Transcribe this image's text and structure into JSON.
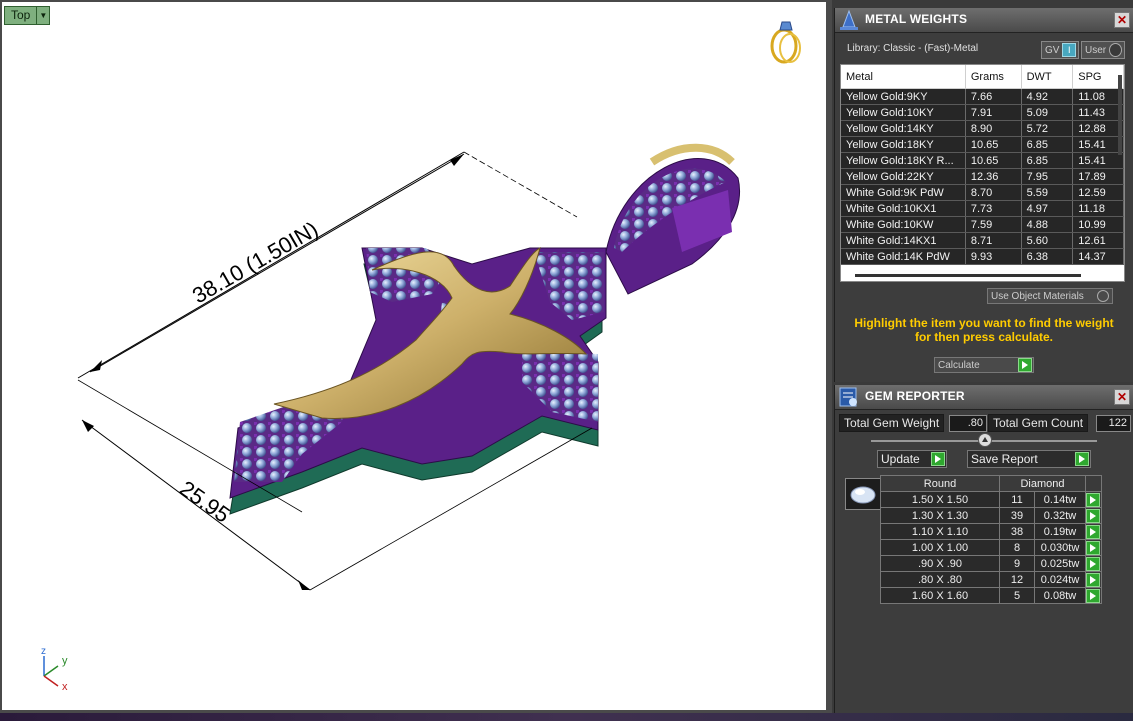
{
  "viewport": {
    "view_label": "Top",
    "dimensions": {
      "length": "38.10  (1.50IN)",
      "width": "25.95"
    },
    "axes": {
      "z": "z",
      "y": "y",
      "x": "x"
    }
  },
  "metal_weights": {
    "title": "METAL WEIGHTS",
    "library": "Library: Classic - (Fast)-Metal",
    "toggle_gv": "GV",
    "toggle_user": "User",
    "columns": [
      "Metal",
      "Grams",
      "DWT",
      "SPG"
    ],
    "rows": [
      [
        "Yellow Gold:9KY",
        "7.66",
        "4.92",
        "11.08"
      ],
      [
        "Yellow Gold:10KY",
        "7.91",
        "5.09",
        "11.43"
      ],
      [
        "Yellow Gold:14KY",
        "8.90",
        "5.72",
        "12.88"
      ],
      [
        "Yellow Gold:18KY",
        "10.65",
        "6.85",
        "15.41"
      ],
      [
        "Yellow Gold:18KY R...",
        "10.65",
        "6.85",
        "15.41"
      ],
      [
        "Yellow Gold:22KY",
        "12.36",
        "7.95",
        "17.89"
      ],
      [
        "White Gold:9K PdW",
        "8.70",
        "5.59",
        "12.59"
      ],
      [
        "White Gold:10KX1",
        "7.73",
        "4.97",
        "11.18"
      ],
      [
        "White Gold:10KW",
        "7.59",
        "4.88",
        "10.99"
      ],
      [
        "White Gold:14KX1",
        "8.71",
        "5.60",
        "12.61"
      ],
      [
        "White Gold:14K PdW",
        "9.93",
        "6.38",
        "14.37"
      ]
    ],
    "use_object_materials": "Use Object Materials",
    "hint": "Highlight the item you want to find the weight for then press calculate.",
    "calculate": "Calculate"
  },
  "gem_reporter": {
    "title": "GEM REPORTER",
    "total_weight_label": "Total Gem Weight",
    "total_weight_value": ".80",
    "total_count_label": "Total Gem Count",
    "total_count_value": "122",
    "update": "Update",
    "save_report": "Save Report",
    "header_shape": "Round",
    "header_type": "Diamond",
    "rows": [
      {
        "size": "1.50 X 1.50",
        "count": "11",
        "tw": "0.14tw"
      },
      {
        "size": "1.30 X 1.30",
        "count": "39",
        "tw": "0.32tw"
      },
      {
        "size": "1.10 X 1.10",
        "count": "38",
        "tw": "0.19tw"
      },
      {
        "size": "1.00 X 1.00",
        "count": "8",
        "tw": "0.030tw"
      },
      {
        "size": ".90 X .90",
        "count": "9",
        "tw": "0.025tw"
      },
      {
        "size": ".80 X .80",
        "count": "12",
        "tw": "0.024tw"
      },
      {
        "size": "1.60 X 1.60",
        "count": "5",
        "tw": "0.08tw"
      }
    ]
  }
}
